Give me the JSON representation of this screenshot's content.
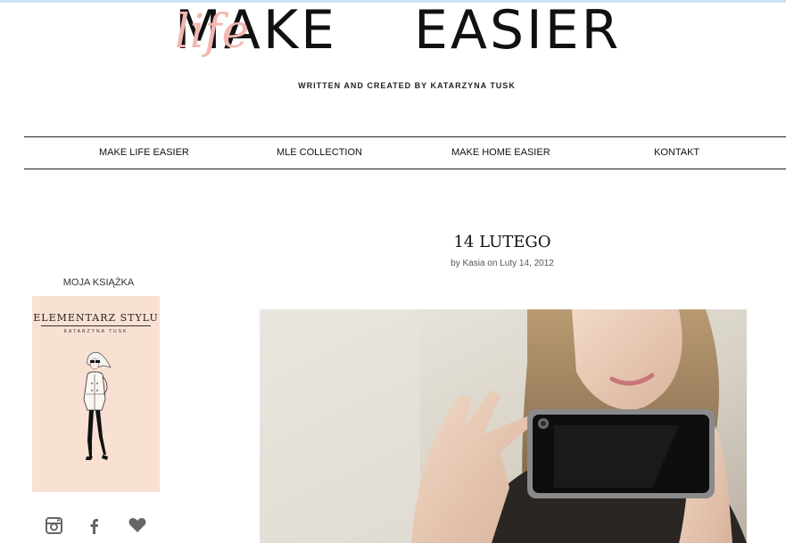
{
  "logo": {
    "make": "MAKE",
    "life": "life",
    "easier": "EASIER",
    "tagline": "WRITTEN AND CREATED BY KATARZYNA TUSK"
  },
  "nav": {
    "items": [
      {
        "label": "MAKE LIFE EASIER"
      },
      {
        "label": "MLE COLLECTION"
      },
      {
        "label": "MAKE HOME EASIER"
      },
      {
        "label": "KONTAKT"
      }
    ]
  },
  "sidebar": {
    "title": "MOJA KSIĄŻKA",
    "book": {
      "title": "ELEMENTARZ STYLU",
      "author": "KATARZYNA TUSK",
      "color": "#f8e0d3"
    },
    "social": [
      {
        "icon": "instagram-icon"
      },
      {
        "icon": "facebook-icon"
      },
      {
        "icon": "heart-icon"
      }
    ]
  },
  "post": {
    "title": "14 LUTEGO",
    "meta": "by Kasia on Luty 14, 2012"
  },
  "colors": {
    "accent_pink": "#f2b7b0",
    "text": "#111111"
  }
}
